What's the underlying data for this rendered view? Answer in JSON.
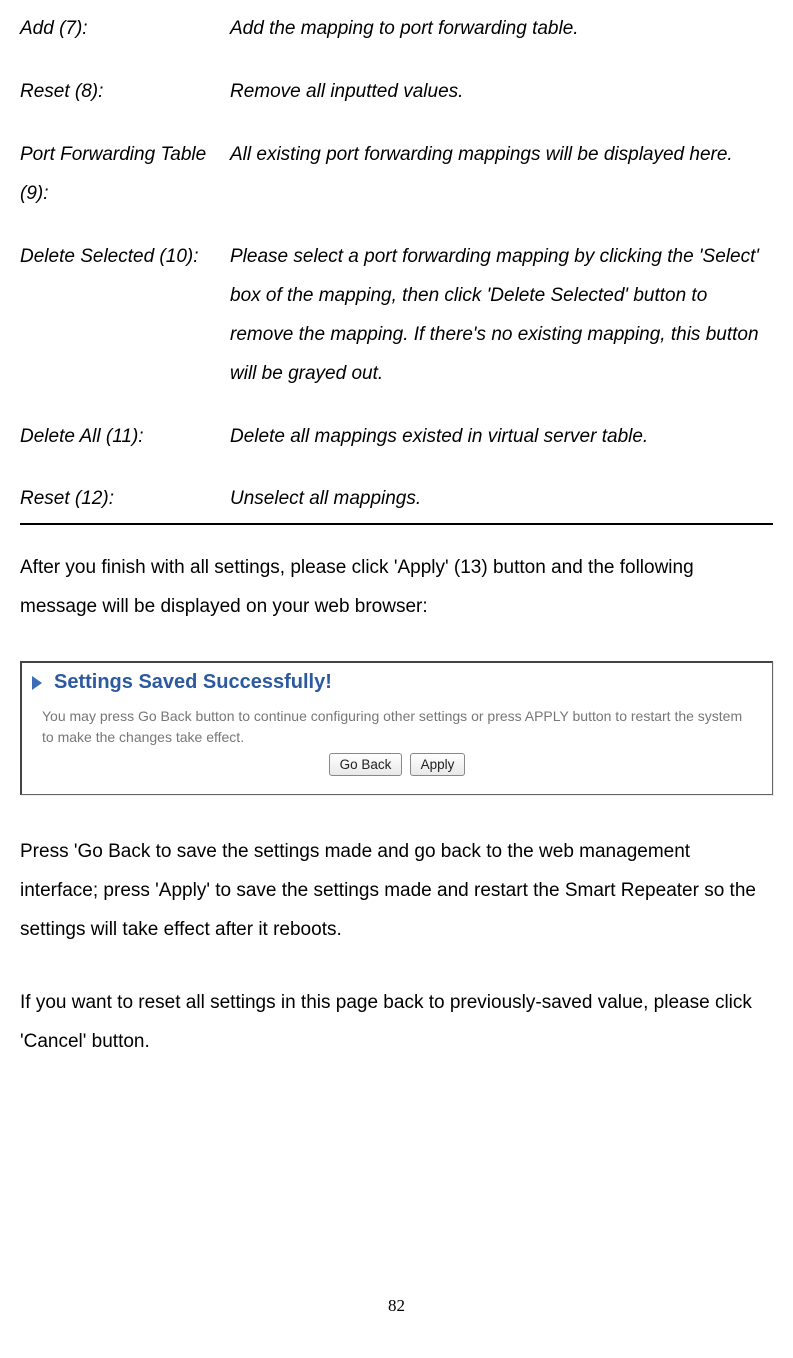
{
  "definitions": [
    {
      "term": "Add (7):",
      "desc": "Add the mapping to port forwarding table."
    },
    {
      "term": "Reset (8):",
      "desc": "Remove all inputted values."
    },
    {
      "term": "Port Forwarding Table (9):",
      "desc": "All existing port forwarding mappings will be displayed here."
    },
    {
      "term": "Delete Selected (10):",
      "desc": "Please select a port forwarding mapping by clicking the 'Select' box of the mapping, then click 'Delete Selected' button to remove the mapping. If there's no existing mapping, this button will be grayed out."
    },
    {
      "term": "Delete All (11):",
      "desc": "Delete all mappings existed in virtual server table."
    },
    {
      "term": "Reset (12):",
      "desc": "Unselect all mappings."
    }
  ],
  "para_after_table": "After you finish with all settings, please click 'Apply' (13) button and the following message will be displayed on your web browser:",
  "dialog": {
    "title": "Settings Saved Successfully!",
    "body": "You may press Go Back button to continue configuring other settings or press APPLY button to restart the system to make the changes take effect.",
    "go_back_label": "Go Back",
    "apply_label": "Apply"
  },
  "para_below_dialog": "Press 'Go Back to save the settings made and go back to the web management interface; press 'Apply' to save the settings made and restart the Smart Repeater so the settings will take effect after it reboots.",
  "para_reset": "If you want to reset all settings in this page back to previously-saved value, please click 'Cancel' button.",
  "page_number": "82"
}
